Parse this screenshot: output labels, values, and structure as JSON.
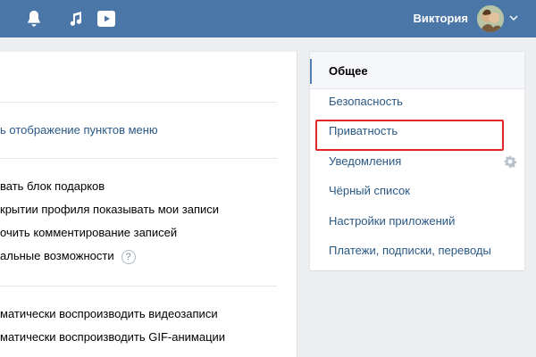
{
  "header": {
    "bg_color": "#4a76a8",
    "icons": [
      "bell-icon",
      "music-icon",
      "video-icon"
    ],
    "user_name": "Виктория"
  },
  "content": {
    "menu_display_link": "ь отображение пунктов меню",
    "options": [
      "вать блок подарков",
      "крытии профиля показывать мои записи",
      "очить комментирование записей",
      "альные возможности"
    ],
    "help_glyph": "?",
    "media_options": [
      "матически воспроизводить видеозаписи",
      "матически воспроизводить GIF-анимации"
    ]
  },
  "settings_menu": {
    "items": [
      {
        "label": "Общее",
        "active": true
      },
      {
        "label": "Безопасность",
        "active": false
      },
      {
        "label": "Приватность",
        "active": false,
        "highlighted": true
      },
      {
        "label": "Уведомления",
        "active": false
      },
      {
        "label": "Чёрный список",
        "active": false
      },
      {
        "label": "Настройки приложений",
        "active": false
      },
      {
        "label": "Платежи, подписки, переводы",
        "active": false
      }
    ],
    "highlight_color": "#e0262b",
    "link_color": "#2a5885"
  }
}
